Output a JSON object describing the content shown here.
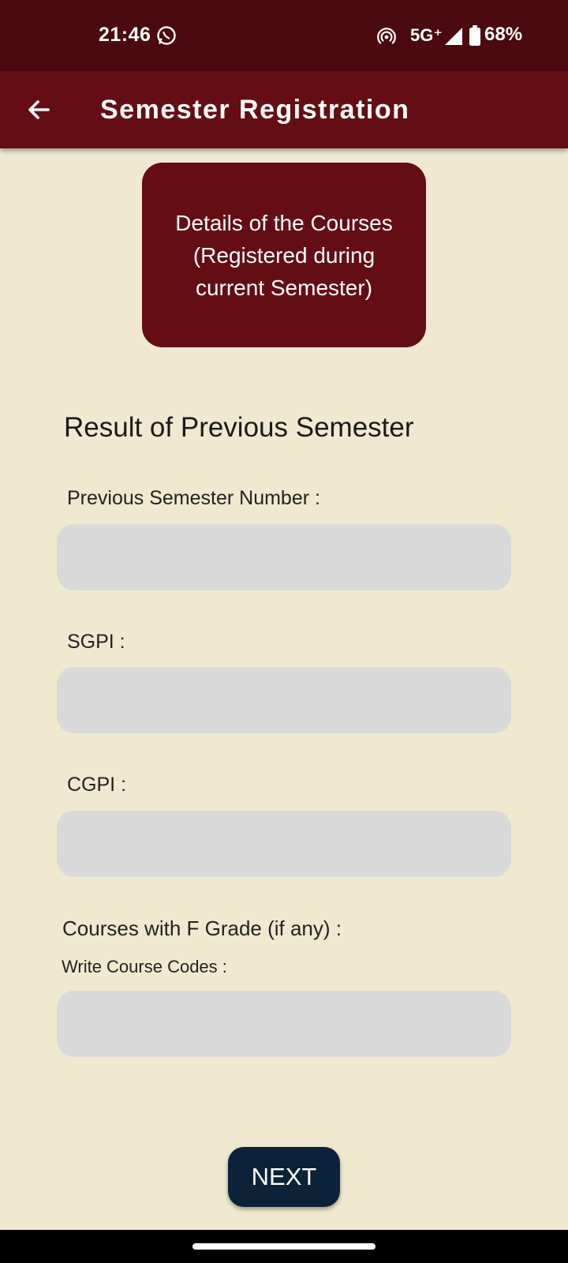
{
  "status_bar": {
    "time": "21:46",
    "network": "5G⁺",
    "battery": "68%",
    "icons": [
      "whatsapp-icon",
      "hotspot-icon",
      "signal-icon",
      "battery-icon"
    ]
  },
  "app_bar": {
    "title": "Semester Registration",
    "back_icon": "arrow-left-icon"
  },
  "details_button": {
    "label": "Details of the Courses (Registered during current Semester)"
  },
  "section": {
    "heading": "Result of Previous Semester"
  },
  "fields": {
    "previous_semester": {
      "label": "Previous Semester Number :",
      "value": ""
    },
    "sgpi": {
      "label": "SGPI :",
      "value": ""
    },
    "cgpi": {
      "label": "CGPI :",
      "value": ""
    },
    "f_grade": {
      "label": "Courses with F Grade (if any) :",
      "sublabel": "Write Course Codes :",
      "value": ""
    }
  },
  "next_button": {
    "label": "NEXT"
  },
  "colors": {
    "status_bar": "#4a0a0e",
    "app_bar": "#640e14",
    "background": "#f0e9cf",
    "input_fill": "#d9d9d9",
    "next_button": "#0c2238"
  }
}
